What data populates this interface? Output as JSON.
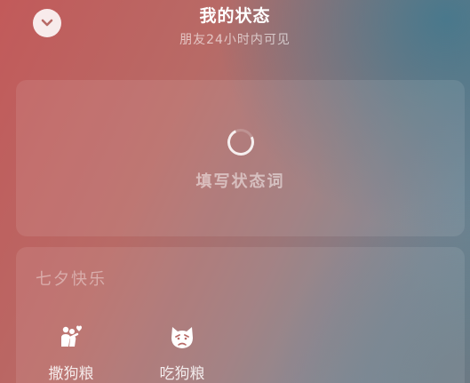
{
  "header": {
    "title": "我的状态",
    "subtitle": "朋友24小时内可见",
    "collapse_icon": "chevron-down-icon"
  },
  "status_card": {
    "placeholder": "填写状态词",
    "loading_icon": "loading-spinner-icon"
  },
  "festival": {
    "title": "七夕快乐",
    "options": [
      {
        "label": "撒狗粮",
        "icon": "couple-heart-icon"
      },
      {
        "label": "吃狗粮",
        "icon": "sad-dog-face-icon"
      }
    ]
  },
  "colors": {
    "background_warm": "#c25a5a",
    "background_cool": "#5c8796",
    "text_primary": "#ffffff"
  }
}
